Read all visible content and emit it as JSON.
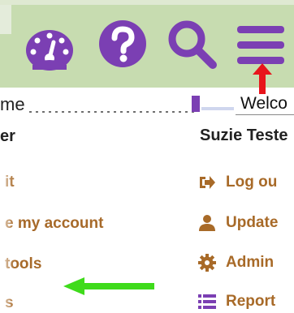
{
  "header": {
    "icons": [
      "dashboard-icon",
      "help-icon",
      "search-icon",
      "hamburger-menu-icon"
    ],
    "icon_color": "#7b3fb3",
    "bar_color": "#c7dcb0"
  },
  "welcome": {
    "left_fragment": "me",
    "right_fragment": "Welco",
    "left_name": "er",
    "right_name": "Suzie Teste"
  },
  "left_menu": [
    {
      "label": "it"
    },
    {
      "label": "e my account"
    },
    {
      "label": "tools"
    },
    {
      "label": "s"
    }
  ],
  "right_menu": [
    {
      "label": "Log ou",
      "icon": "logout-icon"
    },
    {
      "label": "Update",
      "icon": "user-icon"
    },
    {
      "label": "Admin",
      "icon": "gear-icon"
    },
    {
      "label": "Report",
      "icon": "list-icon"
    }
  ],
  "annotations": {
    "red_arrow_color": "#e8141b",
    "green_arrow_color": "#3fdb1b"
  }
}
